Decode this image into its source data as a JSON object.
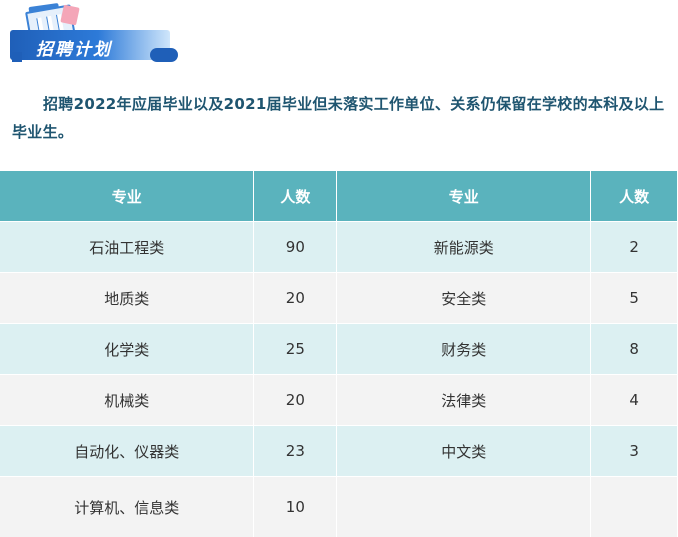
{
  "section_title": "招聘计划",
  "intro": "招聘2022年应届毕业以及2021届毕业但未落实工作单位、关系仍保留在学校的本科及以上毕业生。",
  "table": {
    "headers": [
      "专业",
      "人数",
      "专业",
      "人数"
    ],
    "rows": [
      [
        "石油工程类",
        "90",
        "新能源类",
        "2"
      ],
      [
        "地质类",
        "20",
        "安全类",
        "5"
      ],
      [
        "化学类",
        "25",
        "财务类",
        "8"
      ],
      [
        "机械类",
        "20",
        "法律类",
        "4"
      ],
      [
        "自动化、仪器类",
        "23",
        "中文类",
        "3"
      ],
      [
        "计算机、信息类",
        "10",
        "",
        ""
      ]
    ]
  },
  "colors": {
    "header_bg": "#5ab3bd",
    "row_alt": "#dcf0f2",
    "row_plain": "#f3f3f3",
    "title_blue": "#1f5fb8",
    "intro_text": "#1f5570"
  }
}
